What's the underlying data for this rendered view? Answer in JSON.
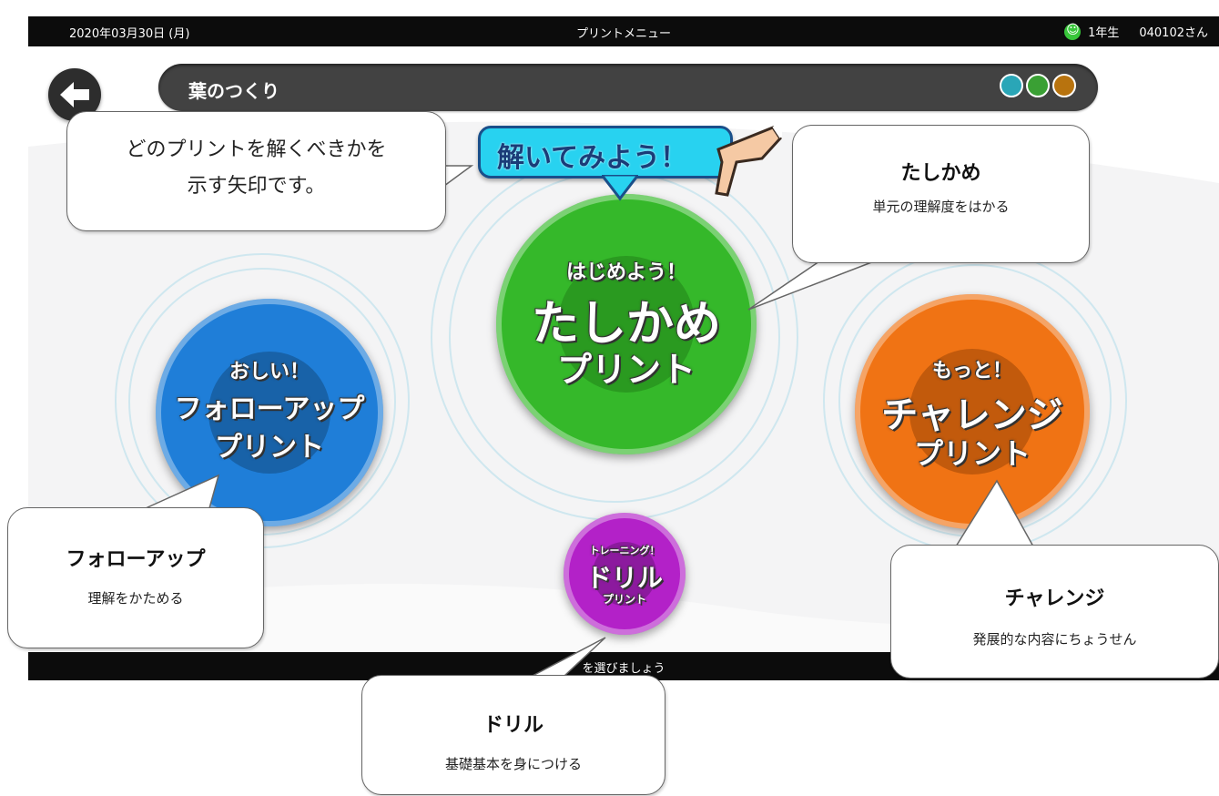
{
  "header": {
    "date": "2020年03月30日 (月)",
    "menu_title": "プリントメニュー",
    "grade": "1年生",
    "student_id": "040102さん"
  },
  "unit": {
    "title": "葉のつくり",
    "progress_dot_colors": [
      "#2aa6b7",
      "#3aa034",
      "#b8730e"
    ]
  },
  "prompt_banner": "解いてみよう！",
  "buttons": {
    "kakunin": {
      "top": "はじめよう！",
      "main": "たしかめ",
      "sub": "プリント",
      "color": "#35b82a"
    },
    "followup": {
      "top": "おしい！",
      "main": "フォローアップ",
      "sub": "プリント",
      "color": "#1f7ed8"
    },
    "challenge": {
      "top": "もっと！",
      "main": "チャレンジ",
      "sub": "プリント",
      "color": "#f07314"
    },
    "drill": {
      "top": "トレーニング！",
      "main": "ドリル",
      "sub": "プリント",
      "color": "#b321c8"
    }
  },
  "footer": {
    "hint": "を選びましょう"
  },
  "callouts": {
    "arrow": {
      "line1": "どのプリントを解くべきかを",
      "line2": "示す矢印です。"
    },
    "tashikame": {
      "title": "たしかめ",
      "desc": "単元の理解度をはかる"
    },
    "followup": {
      "title": "フォローアップ",
      "desc": "理解をかためる"
    },
    "challenge": {
      "title": "チャレンジ",
      "desc": "発展的な内容にちょうせん"
    },
    "drill": {
      "title": "ドリル",
      "desc": "基礎基本を身につける"
    }
  },
  "icons": {
    "back": "arrow-left-icon",
    "smiley": "smiley-icon",
    "pointer": "pointing-hand-icon"
  }
}
